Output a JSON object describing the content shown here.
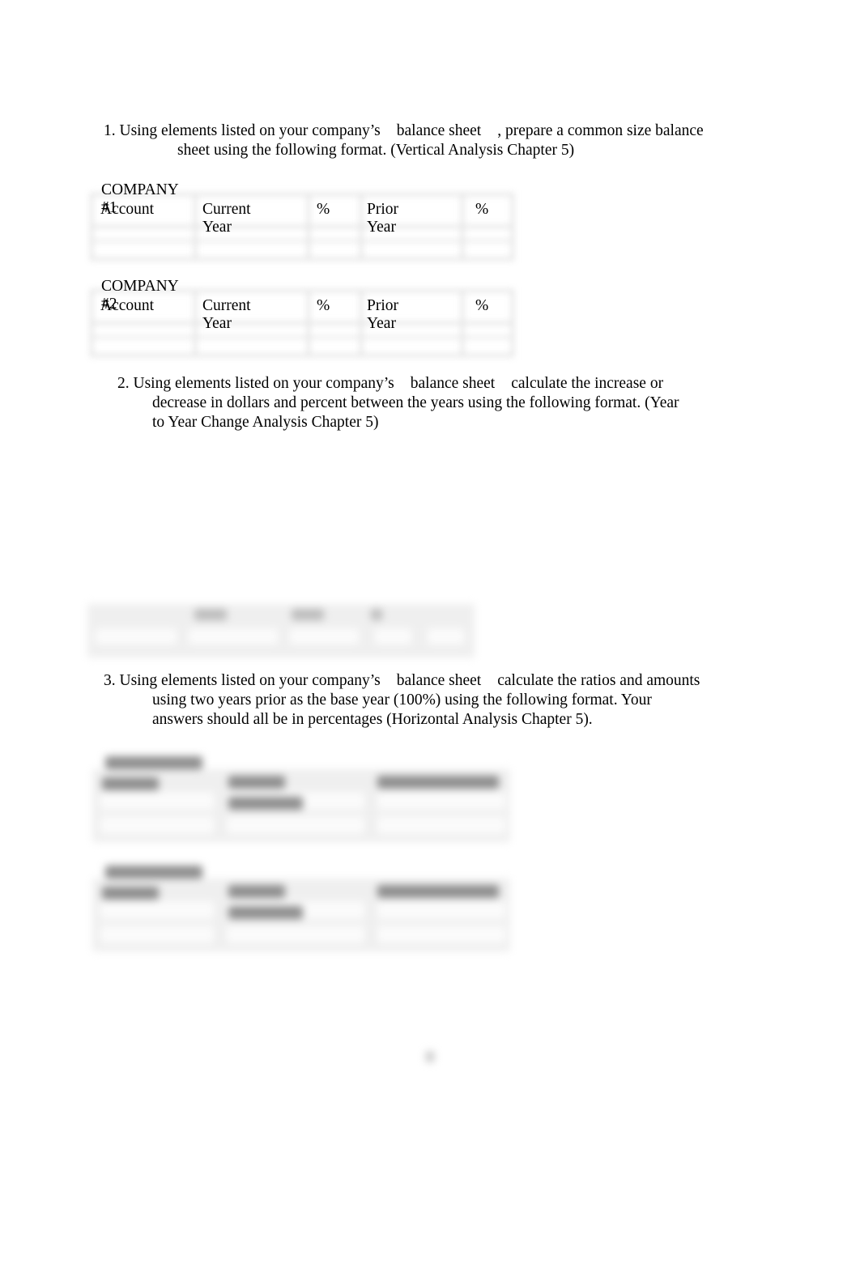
{
  "document": {
    "questions": [
      {
        "number": "1.",
        "line1_a": "Using elements listed on your company’s",
        "line1_b": "balance sheet",
        "line1_c": ", prepare a common size balance",
        "line2": "sheet using the following format. (Vertical Analysis Chapter 5)"
      },
      {
        "number": "2.",
        "line1_a": "Using elements listed on your company’s",
        "line1_b": "balance sheet",
        "line1_c": "calculate the increase or",
        "line2": "decrease in dollars and percent between the years using the following format. (Year",
        "line3": "to Year Change Analysis Chapter 5)"
      },
      {
        "number": "3.",
        "line1_a": "Using elements listed on your company’s",
        "line1_b": "balance sheet",
        "line1_c": "calculate the ratios and amounts",
        "line2": "using two years prior as the base year (100%) using the following format. Your",
        "line3": "answers should all be in percentages (Horizontal Analysis Chapter 5)."
      }
    ],
    "vertical_tables": [
      {
        "title": "COMPANY #1",
        "columns": [
          "Account",
          "Current Year",
          "%",
          "Prior Year",
          "%"
        ]
      },
      {
        "title": "COMPANY #2",
        "columns": [
          "Account",
          "Current Year",
          "%",
          "Prior Year",
          "%"
        ]
      }
    ]
  }
}
